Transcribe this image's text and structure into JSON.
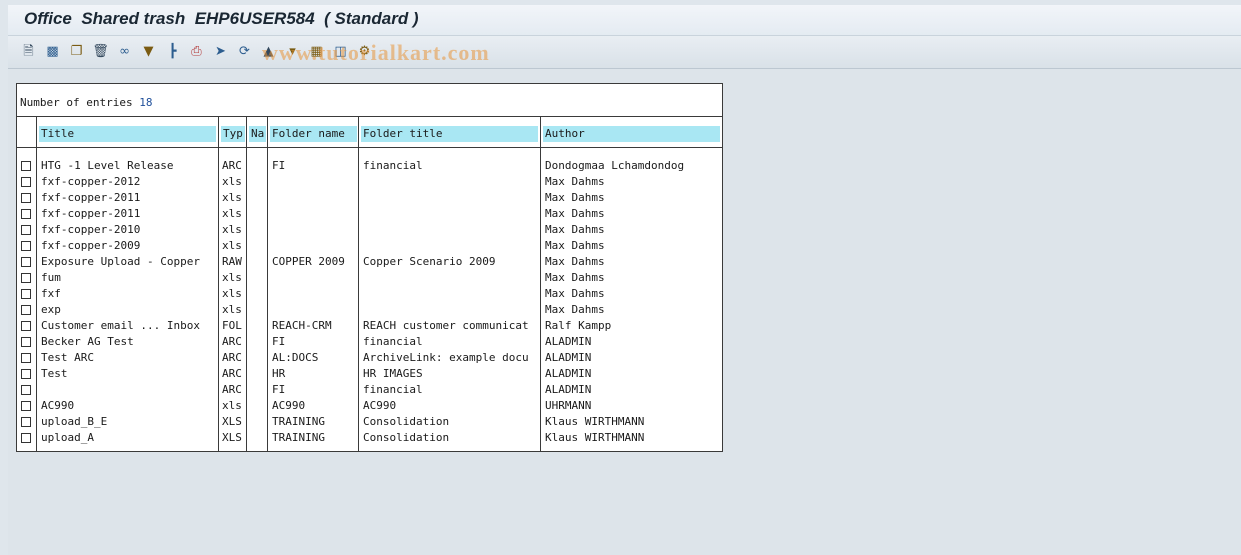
{
  "window": {
    "title": "Office  Shared trash  EHP6USER584  ( Standard )"
  },
  "toolbar": {
    "icons": [
      "new-document-icon",
      "hierarchy-icon",
      "copy-icon",
      "delete-icon",
      "glasses-icon",
      "filter-icon",
      "tree-icon",
      "print-icon",
      "export-icon",
      "refresh-icon",
      "upload-icon",
      "sort-icon",
      "details-icon",
      "layout-icon",
      "settings-icon"
    ]
  },
  "watermark": "www.tutorialkart.com",
  "table": {
    "count_label": "Number of entries",
    "count_value": "18",
    "columns": [
      "Title",
      "Typ",
      "Na",
      "Folder name",
      "Folder title",
      "Author"
    ],
    "rows": [
      {
        "title": "HTG -1 Level Release",
        "typ": "ARC",
        "na": "",
        "folder": "FI",
        "folder_title": "financial",
        "author": "Dondogmaa Lchamdondog"
      },
      {
        "title": "fxf-copper-2012",
        "typ": "xls",
        "na": "",
        "folder": "",
        "folder_title": "",
        "author": "Max Dahms"
      },
      {
        "title": "fxf-copper-2011",
        "typ": "xls",
        "na": "",
        "folder": "",
        "folder_title": "",
        "author": "Max Dahms"
      },
      {
        "title": "fxf-copper-2011",
        "typ": "xls",
        "na": "",
        "folder": "",
        "folder_title": "",
        "author": "Max Dahms"
      },
      {
        "title": "fxf-copper-2010",
        "typ": "xls",
        "na": "",
        "folder": "",
        "folder_title": "",
        "author": "Max Dahms"
      },
      {
        "title": "fxf-copper-2009",
        "typ": "xls",
        "na": "",
        "folder": "",
        "folder_title": "",
        "author": "Max Dahms"
      },
      {
        "title": "Exposure Upload - Copper",
        "typ": "RAW",
        "na": "",
        "folder": "COPPER 2009",
        "folder_title": "Copper Scenario 2009",
        "author": "Max Dahms"
      },
      {
        "title": "fum",
        "typ": "xls",
        "na": "",
        "folder": "",
        "folder_title": "",
        "author": "Max Dahms"
      },
      {
        "title": "fxf",
        "typ": "xls",
        "na": "",
        "folder": "",
        "folder_title": "",
        "author": "Max Dahms"
      },
      {
        "title": "exp",
        "typ": "xls",
        "na": "",
        "folder": "",
        "folder_title": "",
        "author": "Max Dahms"
      },
      {
        "title": "Customer email ... Inbox",
        "typ": "FOL",
        "na": "",
        "folder": "REACH-CRM",
        "folder_title": "REACH customer communicat",
        "author": "Ralf Kampp"
      },
      {
        "title": "Becker AG Test",
        "typ": "ARC",
        "na": "",
        "folder": "FI",
        "folder_title": "financial",
        "author": "ALADMIN"
      },
      {
        "title": "Test ARC",
        "typ": "ARC",
        "na": "",
        "folder": "AL:DOCS",
        "folder_title": "ArchiveLink: example docu",
        "author": "ALADMIN"
      },
      {
        "title": "Test",
        "typ": "ARC",
        "na": "",
        "folder": "HR",
        "folder_title": "HR IMAGES",
        "author": "ALADMIN"
      },
      {
        "title": "",
        "typ": "ARC",
        "na": "",
        "folder": "FI",
        "folder_title": "financial",
        "author": "ALADMIN"
      },
      {
        "title": "AC990",
        "typ": "xls",
        "na": "",
        "folder": "AC990",
        "folder_title": "AC990",
        "author": "UHRMANN"
      },
      {
        "title": "upload_B_E",
        "typ": "XLS",
        "na": "",
        "folder": "TRAINING",
        "folder_title": "Consolidation",
        "author": "Klaus WIRTHMANN"
      },
      {
        "title": "upload_A",
        "typ": "XLS",
        "na": "",
        "folder": "TRAINING",
        "folder_title": "Consolidation",
        "author": "Klaus WIRTHMANN"
      }
    ]
  }
}
